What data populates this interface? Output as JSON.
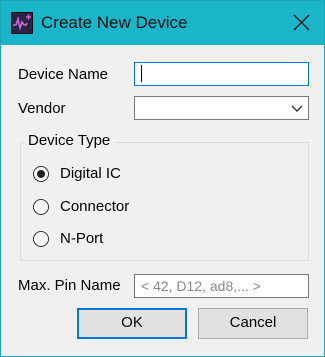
{
  "window": {
    "title": "Create New Device",
    "accent_color": "#1ab5c8",
    "title_icon": "app-logo-icon",
    "close_icon": "close-icon"
  },
  "form": {
    "device_name": {
      "label": "Device Name",
      "value": ""
    },
    "vendor": {
      "label": "Vendor",
      "selected": "",
      "icon": "chevron-down-icon"
    },
    "device_type": {
      "label": "Device Type",
      "options": [
        {
          "label": "Digital IC",
          "checked": true
        },
        {
          "label": "Connector",
          "checked": false
        },
        {
          "label": "N-Port",
          "checked": false
        }
      ]
    },
    "max_pin_name": {
      "label": "Max. Pin Name",
      "placeholder": "< 42, D12, ad8,... >",
      "value": ""
    }
  },
  "buttons": {
    "ok": "OK",
    "cancel": "Cancel"
  }
}
